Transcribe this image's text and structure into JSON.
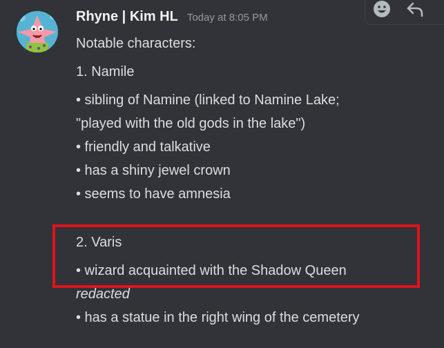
{
  "message": {
    "username": "Rhyne | Kim HL",
    "timestamp": "Today at 8:05 PM",
    "avatar_icon": "patrick-star-avatar",
    "toolbar": {
      "emoji_icon": "add-reaction-icon",
      "reply_icon": "reply-icon"
    },
    "lines": [
      "Notable characters:",
      "1. Namile",
      "• sibling of Namine (linked to Namine Lake;",
      "\"played with the old gods in the lake\")",
      "• friendly and talkative",
      "• has a shiny jewel crown",
      "• seems to have amnesia",
      "2. Varis",
      "• wizard acquainted with the Shadow Queen",
      "redacted",
      "• has a statue in the right wing of the cemetery"
    ]
  },
  "colors": {
    "background": "#313338",
    "text": "#dbdee1",
    "username": "#f2f3f5",
    "timestamp": "#949ba4",
    "highlight_box": "#e0131c"
  }
}
